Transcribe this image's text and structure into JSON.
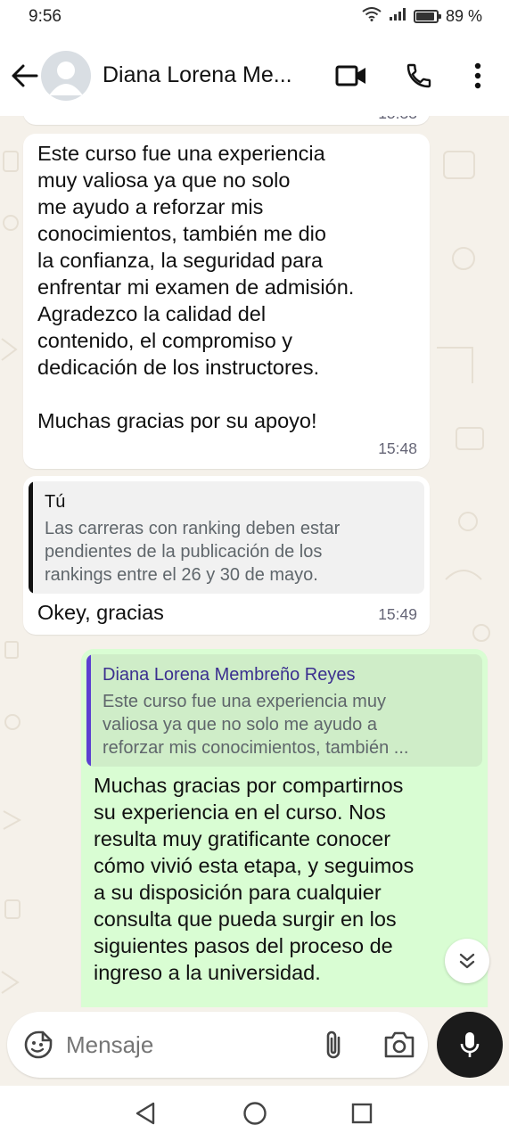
{
  "status_bar": {
    "time": "9:56",
    "battery": "89 %"
  },
  "header": {
    "contact_name": "Diana Lorena Me..."
  },
  "messages": [
    {
      "direction": "incoming",
      "text": "Este curso fue una experiencia\nmuy valiosa ya que no solo\nme ayudo a reforzar mis\nconocimientos, también me dio\nla confianza, la seguridad para\nenfrentar mi examen de admisión.\nAgradezco la calidad del\ncontenido, el compromiso y\ndedicación de los instructores.\n\nMuchas gracias por su apoyo!",
      "time": "15:48"
    },
    {
      "direction": "incoming",
      "quote": {
        "author": "Tú",
        "text": "Las carreras con ranking deben estar\npendientes de la publicación de los\nrankings entre el 26 y 30 de mayo."
      },
      "text": "Okey,  gracias",
      "time": "15:49"
    },
    {
      "direction": "outgoing",
      "quote": {
        "author": "Diana Lorena Membreño Reyes",
        "text": "Este curso fue una experiencia muy\nvaliosa ya que no solo me ayudo a\nreforzar mis conocimientos, también ..."
      },
      "text": "Muchas gracias por compartirnos\nsu experiencia en el curso. Nos\nresulta muy gratificante conocer\ncómo vivió esta etapa, y seguimos\na su disposición para cualquier\nconsulta que pueda surgir en los\nsiguientes pasos del proceso de\ningreso a la universidad."
    }
  ],
  "composer": {
    "placeholder": "Mensaje"
  },
  "colors": {
    "incoming_bubble": "#ffffff",
    "outgoing_bubble": "#d9fdd3",
    "self_quote_accent": "#111111",
    "contact_quote_accent": "#5b3fd1",
    "mic_button": "#1b1b1b"
  },
  "icons": {
    "header": [
      "back-arrow-icon",
      "avatar-placeholder-icon",
      "video-call-icon",
      "phone-call-icon",
      "more-vert-icon"
    ],
    "composer": [
      "emoji-sticker-icon",
      "attach-paperclip-icon",
      "camera-icon",
      "microphone-icon"
    ],
    "navigation": [
      "nav-back-icon",
      "nav-home-icon",
      "nav-recents-icon"
    ]
  }
}
